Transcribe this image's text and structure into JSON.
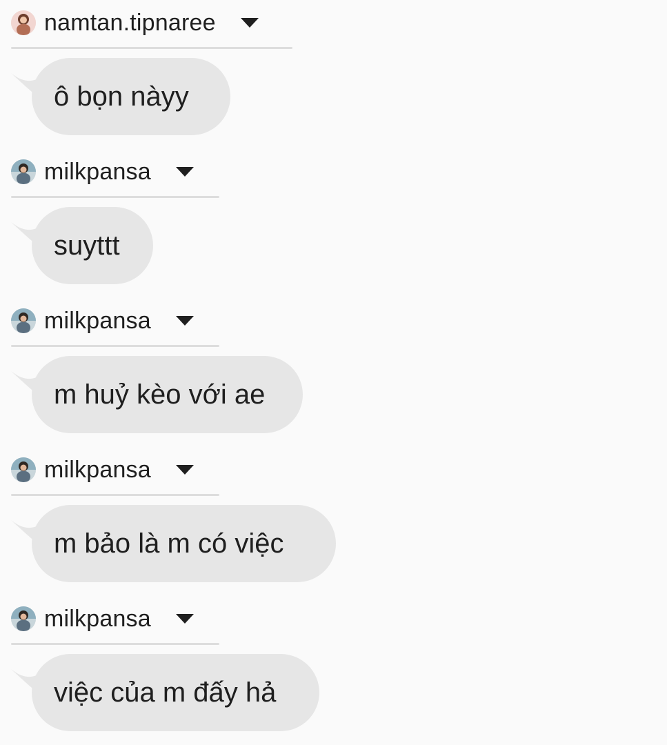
{
  "messages": [
    {
      "sender": "namtan.tipnaree",
      "avatar": "profile-photo-avatar",
      "dropdown_icon": "caret-down-icon",
      "text": "ô bọn nàyy"
    },
    {
      "sender": "milkpansa",
      "avatar": "profile-photo-avatar",
      "dropdown_icon": "caret-down-icon",
      "text": "suyttt"
    },
    {
      "sender": "milkpansa",
      "avatar": "profile-photo-avatar",
      "dropdown_icon": "caret-down-icon",
      "text": "m huỷ kèo với ae"
    },
    {
      "sender": "milkpansa",
      "avatar": "profile-photo-avatar",
      "dropdown_icon": "caret-down-icon",
      "text": "m bảo là m có việc"
    },
    {
      "sender": "milkpansa",
      "avatar": "profile-photo-avatar",
      "dropdown_icon": "caret-down-icon",
      "text": "việc của m đấy hả"
    }
  ],
  "colors": {
    "background": "#fafafa",
    "bubble": "#e6e6e6",
    "text": "#1f1f1f",
    "rule": "#dddddd"
  }
}
